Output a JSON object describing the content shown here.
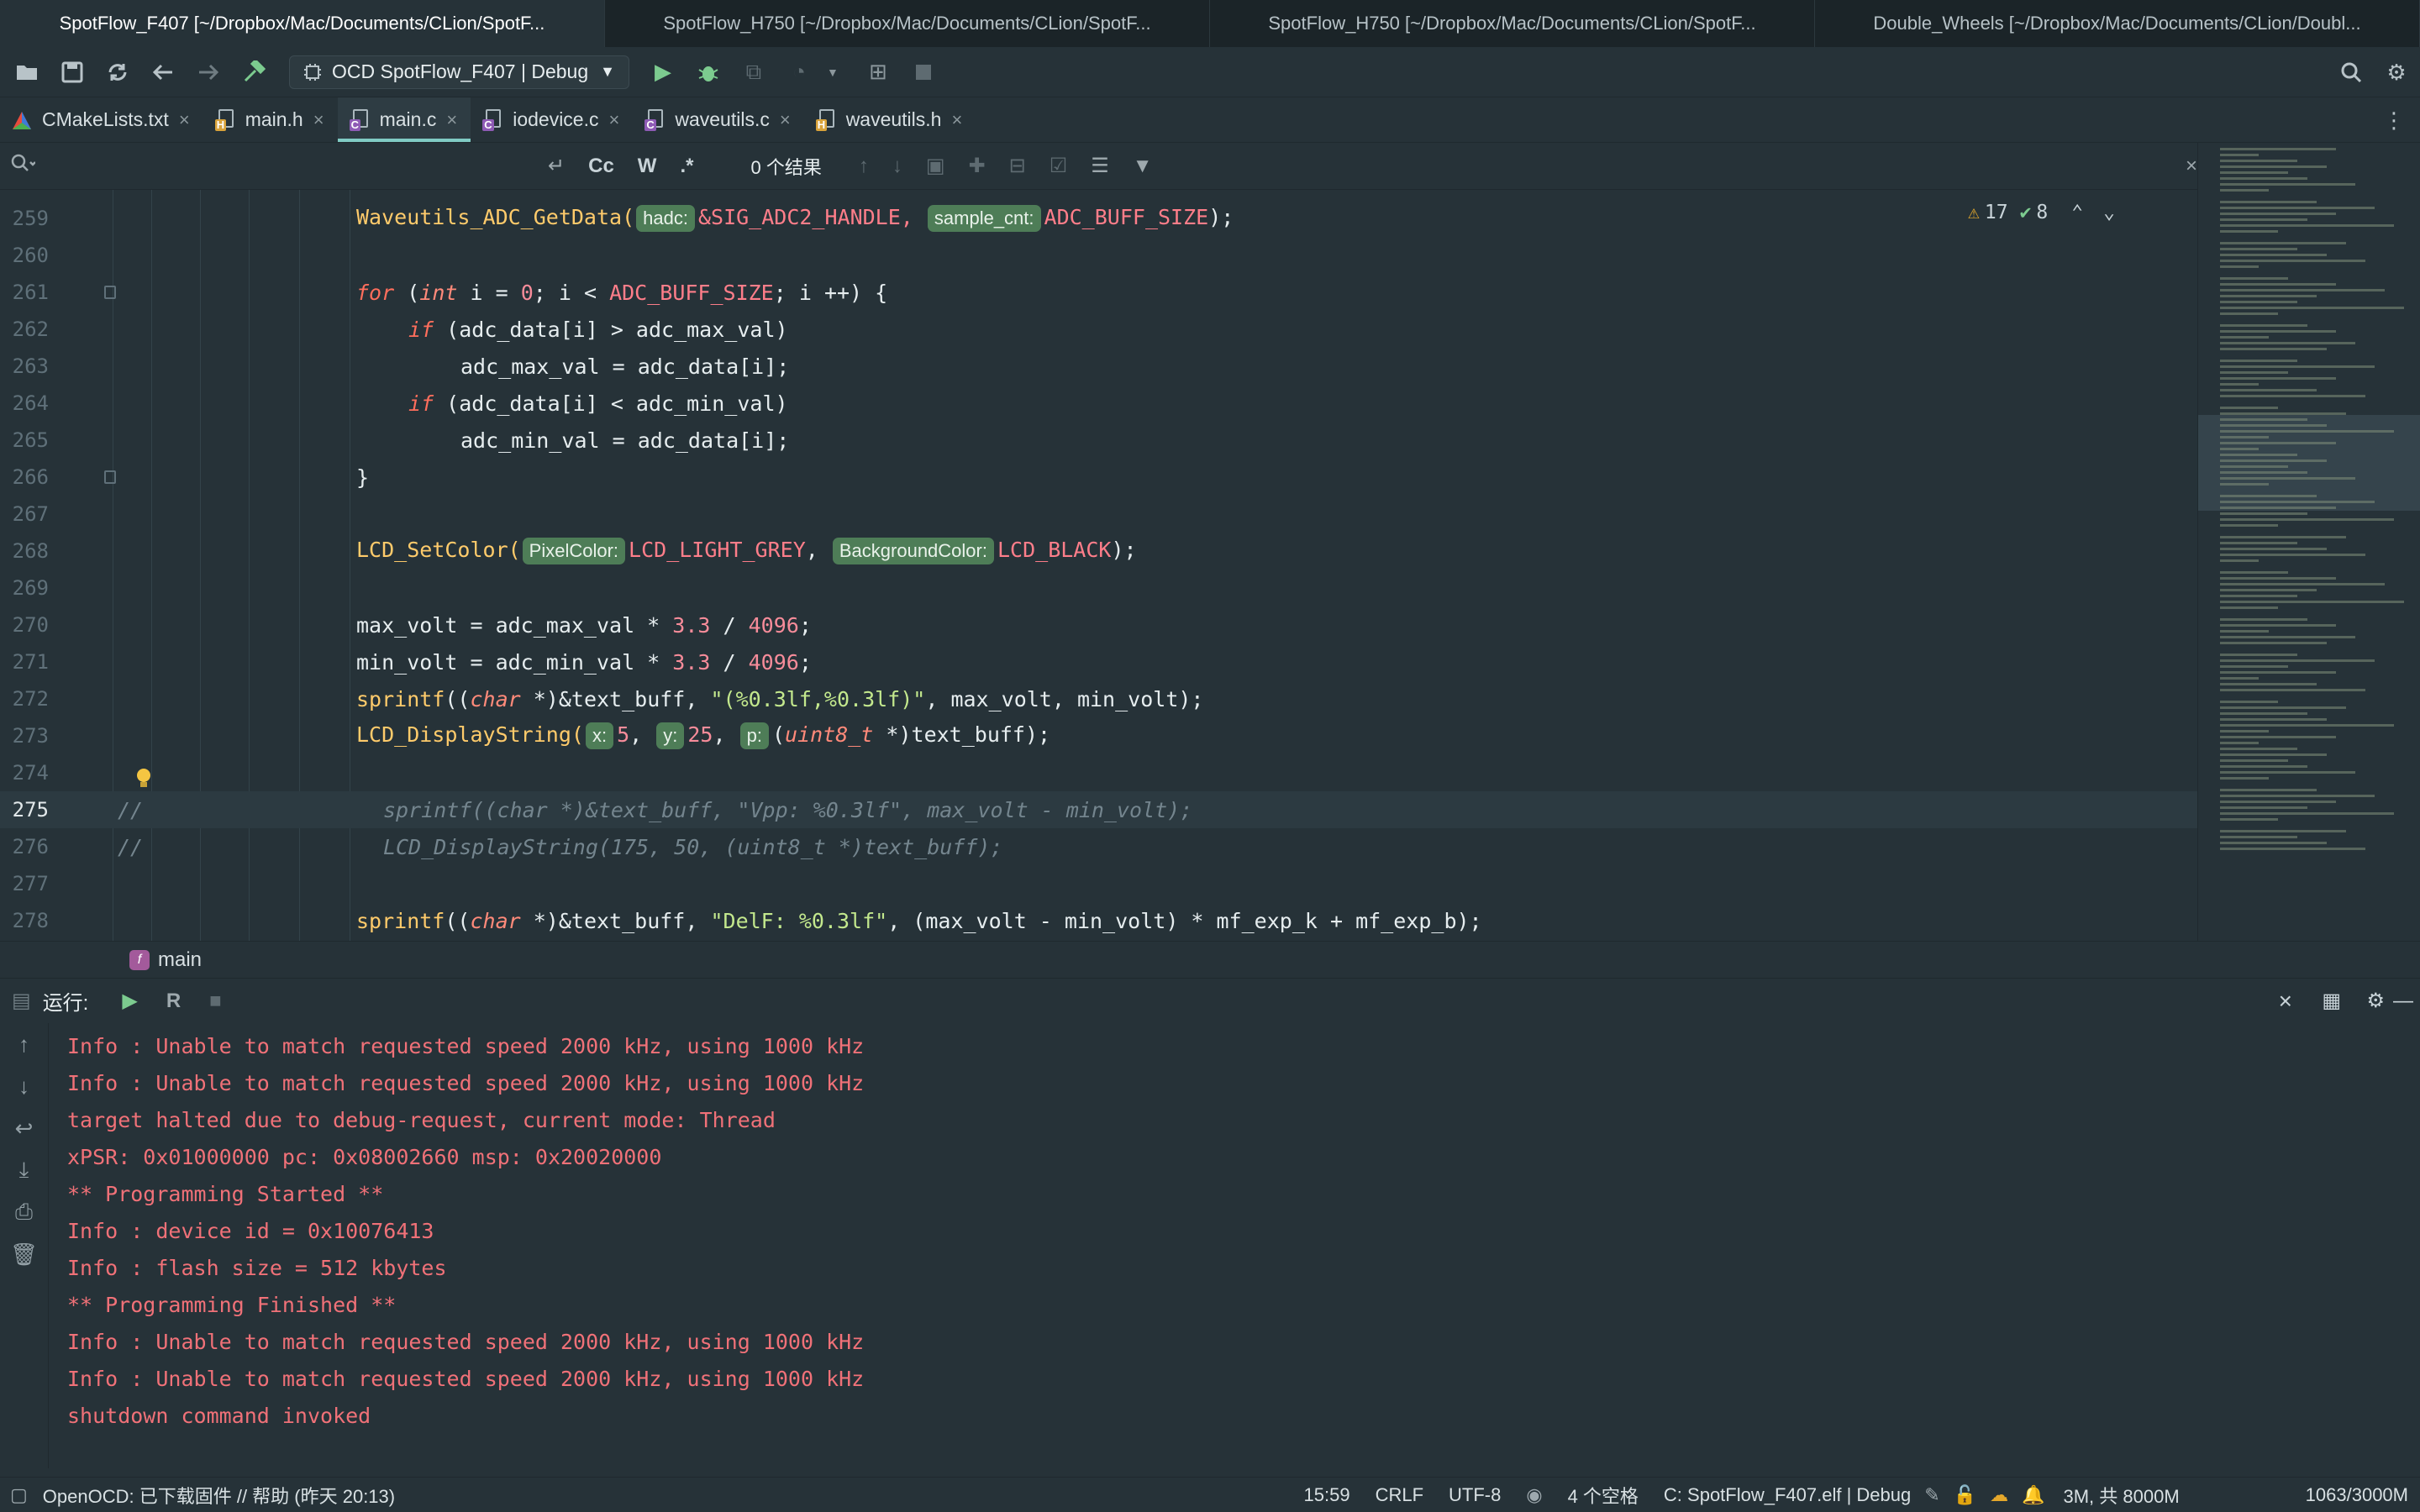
{
  "window_tabs": [
    {
      "title": "SpotFlow_F407 [~/Dropbox/Mac/Documents/CLion/SpotF...",
      "active": true
    },
    {
      "title": "SpotFlow_H750 [~/Dropbox/Mac/Documents/CLion/SpotF...",
      "active": false
    },
    {
      "title": "SpotFlow_H750 [~/Dropbox/Mac/Documents/CLion/SpotF...",
      "active": false
    },
    {
      "title": "Double_Wheels [~/Dropbox/Mac/Documents/CLion/Doubl...",
      "active": false
    }
  ],
  "toolbar": {
    "run_config": "OCD SpotFlow_F407 | Debug",
    "icons": [
      "open-icon",
      "save-icon",
      "sync-icon",
      "back-icon",
      "forward-icon",
      "build-icon"
    ]
  },
  "editor_tabs": [
    {
      "label": "CMakeLists.txt",
      "kind": "cmake"
    },
    {
      "label": "main.h",
      "kind": "h"
    },
    {
      "label": "main.c",
      "kind": "c",
      "active": true
    },
    {
      "label": "iodevice.c",
      "kind": "c"
    },
    {
      "label": "waveutils.c",
      "kind": "c"
    },
    {
      "label": "waveutils.h",
      "kind": "h"
    }
  ],
  "find": {
    "result": "0 个结果",
    "cc": "Cc",
    "w": "W",
    "regex": ".*"
  },
  "inspections": {
    "warnings": "17",
    "weak": "8"
  },
  "code": {
    "l259": {
      "n": "259",
      "fn": "Waveutils_ADC_GetData(",
      "h1": "hadc:",
      "a1": "&SIG_ADC2_HANDLE,",
      "h2": "sample_cnt:",
      "a2": "ADC_BUFF_SIZE",
      "end": ");"
    },
    "l260": {
      "n": "260"
    },
    "l261": {
      "n": "261",
      "kw": "for",
      "p1": " (",
      "ty": "int",
      "p2": " i = ",
      "z": "0",
      "p3": "; i < ",
      "mac": "ADC_BUFF_SIZE",
      "p4": "; i ++) {"
    },
    "l262": {
      "n": "262",
      "kw": "if",
      "rest": " (adc_data[i] > adc_max_val)"
    },
    "l263": {
      "n": "263",
      "rest": "adc_max_val = adc_data[i];"
    },
    "l264": {
      "n": "264",
      "kw": "if",
      "rest": " (adc_data[i] < adc_min_val)"
    },
    "l265": {
      "n": "265",
      "rest": "adc_min_val = adc_data[i];"
    },
    "l266": {
      "n": "266",
      "rest": "}"
    },
    "l267": {
      "n": "267"
    },
    "l268": {
      "n": "268",
      "fn": "LCD_SetColor(",
      "h1": "PixelColor:",
      "a1": "LCD_LIGHT_GREY",
      "sep": ", ",
      "h2": "BackgroundColor:",
      "a2": "LCD_BLACK",
      "end": ");"
    },
    "l269": {
      "n": "269"
    },
    "l270": {
      "n": "270",
      "p1": "max_volt = adc_max_val * ",
      "n1": "3.3",
      "p2": " / ",
      "n2": "4096",
      "p3": ";"
    },
    "l271": {
      "n": "271",
      "p1": "min_volt = adc_min_val * ",
      "n1": "3.3",
      "p2": " / ",
      "n2": "4096",
      "p3": ";"
    },
    "l272": {
      "n": "272",
      "fn": "sprintf",
      "p1": "((",
      "ty": "char",
      "p2": " *)&text_buff, ",
      "str": "\"(%0.3lf,%0.3lf)\"",
      "p3": ", max_volt, min_volt);"
    },
    "l273": {
      "n": "273",
      "fn": "LCD_DisplayString(",
      "h1": "x:",
      "v1": "5",
      "h2": "y:",
      "v2": "25",
      "h3": "p:",
      "p1": "(",
      "ty": "uint8_t",
      "p2": " *)text_buff);"
    },
    "l274": {
      "n": "274"
    },
    "l275": {
      "n": "275",
      "c1": "//",
      "c2": "sprintf((char *)&text_buff, \"Vpp: %0.3lf\", max_volt - min_volt);"
    },
    "l276": {
      "n": "276",
      "c1": "//",
      "c2": "LCD_DisplayString(175, 50, (uint8_t *)text_buff);"
    },
    "l277": {
      "n": "277"
    },
    "l278": {
      "n": "278",
      "fn": "sprintf",
      "p1": "((",
      "ty": "char",
      "p2": " *)&text_buff, ",
      "str": "\"DelF: %0.3lf\"",
      "p3": ", (max_volt - min_volt) * mf_exp_k + mf_exp_b);"
    }
  },
  "breadcrumb": {
    "icon": "f",
    "label": "main"
  },
  "run": {
    "title": "运行:"
  },
  "console": [
    "Info : Unable to match requested speed 2000 kHz, using 1000 kHz",
    "Info : Unable to match requested speed 2000 kHz, using 1000 kHz",
    "target halted due to debug-request, current mode: Thread",
    "xPSR: 0x01000000 pc: 0x08002660 msp: 0x20020000",
    "** Programming Started **",
    "Info : device id = 0x10076413",
    "Info : flash size = 512 kbytes",
    "** Programming Finished **",
    "Info : Unable to match requested speed 2000 kHz, using 1000 kHz",
    "Info : Unable to match requested speed 2000 kHz, using 1000 kHz",
    "shutdown command invoked"
  ],
  "status": {
    "message": "OpenOCD: 已下载固件 // 帮助 (昨天 20:13)",
    "position": "15:59",
    "line_sep": "CRLF",
    "encoding": "UTF-8",
    "indent": "4 个空格",
    "context": "C: SpotFlow_F407.elf | Debug",
    "memory": "3M, 共 8000M",
    "heap": "1063/3000M"
  },
  "colors": {
    "accent": "#80cbc4",
    "error_text": "#f07178",
    "hint_bg": "#4e7d57",
    "warning": "#e5a82b"
  }
}
